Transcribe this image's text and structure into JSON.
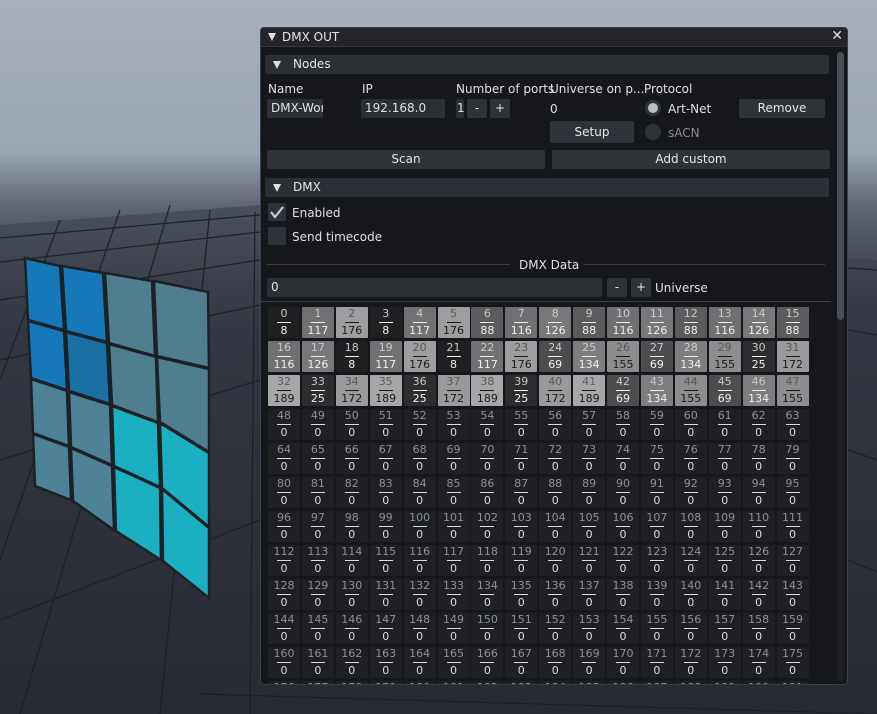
{
  "window": {
    "title": "DMX OUT",
    "close_glyph": "✕"
  },
  "nodes": {
    "header": "Nodes",
    "columns": {
      "name": "Name",
      "ip": "IP",
      "ports": "Number of ports",
      "universe": "Universe on p...",
      "protocol": "Protocol"
    },
    "row": {
      "name_value": "DMX-Wor",
      "ip_value": "192.168.0",
      "ports_value": "1",
      "minus_label": "-",
      "plus_label": "+",
      "universe_value": "0",
      "setup_label": "Setup",
      "artnet_label": "Art-Net",
      "sacn_label": "sACN",
      "remove_label": "Remove"
    },
    "scan_label": "Scan",
    "add_custom_label": "Add custom"
  },
  "dmx": {
    "header": "DMX",
    "enabled_label": "Enabled",
    "enabled_checked": true,
    "send_timecode_label": "Send timecode",
    "send_timecode_checked": false,
    "data_title": "DMX Data",
    "universe_value": "0",
    "universe_minus": "-",
    "universe_plus": "+",
    "universe_label": "Universe"
  },
  "channels": {
    "columns": 16,
    "visible_rows": 12,
    "values": [
      8,
      117,
      176,
      8,
      117,
      176,
      88,
      116,
      126,
      88,
      116,
      126,
      88,
      116,
      126,
      88,
      116,
      126,
      8,
      117,
      176,
      8,
      117,
      176,
      69,
      134,
      155,
      69,
      134,
      155,
      25,
      172,
      189,
      25,
      172,
      189,
      25,
      172,
      189,
      25,
      172,
      189,
      69,
      134,
      155,
      69,
      134,
      155
    ]
  },
  "colors": {
    "window_bg": "#16171b",
    "panel_header": "#2c2f36",
    "accent_blue": "#1579b9",
    "accent_cyan": "#1ab0c1",
    "accent_gray": "#4f7f94"
  }
}
